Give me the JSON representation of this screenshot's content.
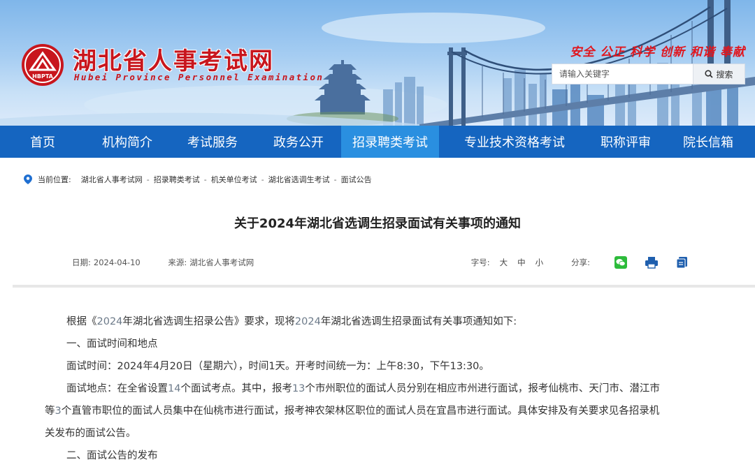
{
  "header": {
    "logo_text": "HBPTA",
    "site_title": "湖北省人事考试网",
    "site_subtitle": "Hubei Province Personnel Examination",
    "slogan": "安全 公正 科学 创新 和谐 奉献",
    "search": {
      "placeholder": "请输入关键字",
      "button_label": "搜索"
    }
  },
  "nav": {
    "items": [
      {
        "label": "首页",
        "active": false
      },
      {
        "label": "机构简介",
        "active": false
      },
      {
        "label": "考试服务",
        "active": false
      },
      {
        "label": "政务公开",
        "active": false
      },
      {
        "label": "招录聘类考试",
        "active": true
      },
      {
        "label": "专业技术资格考试",
        "active": false
      },
      {
        "label": "职称评审",
        "active": false
      },
      {
        "label": "院长信箱",
        "active": false
      }
    ]
  },
  "breadcrumb": {
    "prefix": "当前位置:",
    "items": [
      "湖北省人事考试网",
      "招录聘类考试",
      "机关单位考试",
      "湖北省选调生考试",
      "面试公告"
    ],
    "separator": "-"
  },
  "article": {
    "title": "关于2024年湖北省选调生招录面试有关事项的通知",
    "date_label": "日期:",
    "date": "2024-04-10",
    "source_label": "来源:",
    "source": "湖北省人事考试网",
    "font_size_label": "字号:",
    "font_sizes": [
      "大",
      "中",
      "小"
    ],
    "share_label": "分享:",
    "share_icons": [
      "wechat-icon",
      "print-icon",
      "copy-icon"
    ],
    "paragraphs": {
      "p1_a": "根据《",
      "p1_b": "2024",
      "p1_c": "年湖北省选调生招录公告》要求，现将",
      "p1_d": "2024",
      "p1_e": "年湖北省选调生招录面试有关事项通知如下:",
      "h1": "一、面试时间和地点",
      "p2": "面试时间：2024年4月20日（星期六），时间1天。开考时间统一为：上午8:30，下午13:30。",
      "p3_a": "面试地点：在全省设置",
      "p3_b": "14",
      "p3_c": "个面试考点。其中，报考",
      "p3_d": "13",
      "p3_e": "个市州职位的面试人员分别在相应市州进行面试，报考仙桃市、天门市、潜江市",
      "p3_f": "等",
      "p3_g": "3",
      "p3_h": "个直管市职位的面试人员集中在仙桃市进行面试，报考神农架林区职位的面试人员在宜昌市进行面试。具体安排及有关要求见各招录机",
      "p3_i": "关发布的面试公告。",
      "h2": "二、面试公告的发布"
    }
  },
  "colors": {
    "nav_bg": "#1565c0",
    "nav_active": "#2a8fe0",
    "brand_red": "#c8161d",
    "highlight_number": "#6c7a89"
  }
}
